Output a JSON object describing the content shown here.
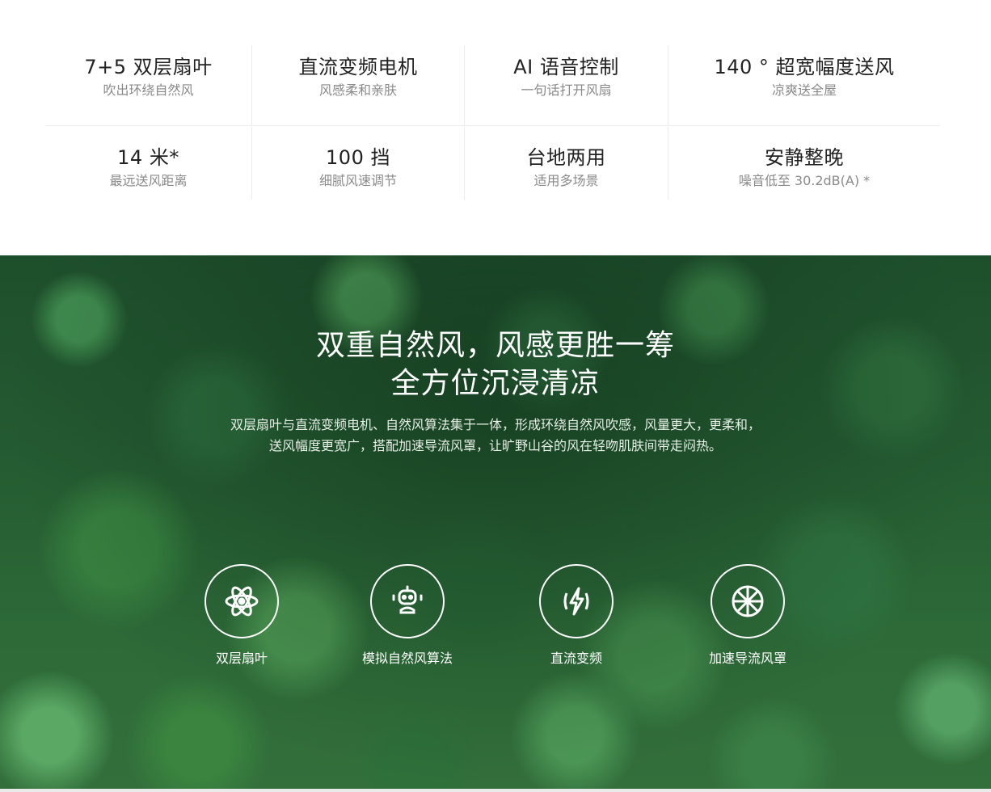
{
  "specs": {
    "row1": [
      {
        "title": "7+5 双层扇叶",
        "sub": "吹出环绕自然风"
      },
      {
        "title": "直流变频电机",
        "sub": "风感柔和亲肤"
      },
      {
        "title": "AI 语音控制",
        "sub": "一句话打开风扇"
      },
      {
        "title": "140 ° 超宽幅度送风",
        "sub": "凉爽送全屋"
      }
    ],
    "row2": [
      {
        "title": "14 米*",
        "sub": "最远送风距离"
      },
      {
        "title": "100 挡",
        "sub": "细腻风速调节"
      },
      {
        "title": "台地两用",
        "sub": "适用多场景"
      },
      {
        "title": "安静整晚",
        "sub": "噪音低至  30.2dB(A) *"
      }
    ]
  },
  "banner": {
    "headline_line1": "双重自然风，风感更胜一筹",
    "headline_line2": "全方位沉浸清凉",
    "desc_line1": "双层扇叶与直流变频电机、自然风算法集于一体，形成环绕自然风吹感，风量更大，更柔和，",
    "desc_line2": "送风幅度更宽广，搭配加速导流风罩，让旷野山谷的风在轻吻肌肤间带走闷热。",
    "features": [
      {
        "icon": "atom-icon",
        "label": "双层扇叶"
      },
      {
        "icon": "robot-icon",
        "label": "模拟自然风算法"
      },
      {
        "icon": "lightning-icon",
        "label": "直流变频"
      },
      {
        "icon": "wheel-icon",
        "label": "加速导流风罩"
      }
    ]
  }
}
